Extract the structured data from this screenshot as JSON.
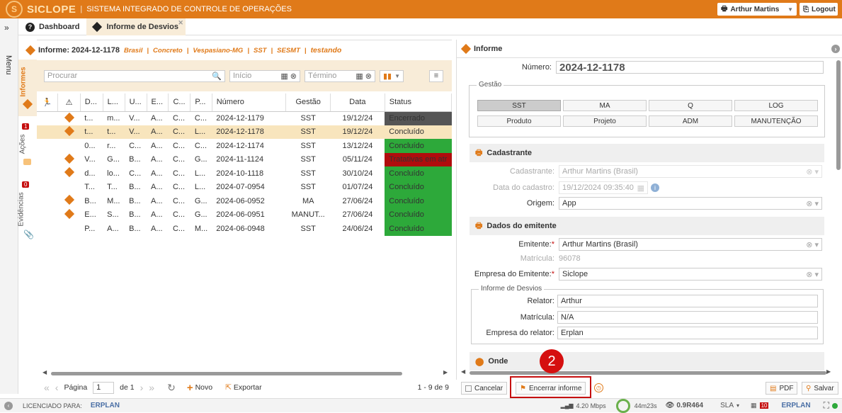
{
  "header": {
    "brand": "SICLOPE",
    "subtitle": "SISTEMA INTEGRADO DE CONTROLE DE OPERAÇÕES",
    "user_label": "Arthur Martins",
    "logout_label": "Logout"
  },
  "side_menu_label": "Menu",
  "tabs": [
    {
      "label": "Dashboard",
      "icon": "help-circle-icon"
    },
    {
      "label": "Informe de Desvios",
      "icon": "diamond-icon"
    }
  ],
  "vertical_tabs": [
    {
      "label": "Informes"
    },
    {
      "label": "Ações",
      "badge": "1"
    },
    {
      "label": "Evidências",
      "badge": "0"
    }
  ],
  "left": {
    "header_title": "Informe: 2024-12-1178",
    "header_tags": [
      "Brasil",
      "Concreto",
      "Vespasiano-MG",
      "SST",
      "SESMT"
    ],
    "header_note": "testando",
    "search_placeholder": "Procurar",
    "start_placeholder": "Início",
    "end_placeholder": "Término",
    "columns": [
      "D...",
      "L...",
      "U...",
      "E...",
      "C...",
      "P...",
      "Número",
      "Gestão",
      "Data",
      "Status"
    ],
    "rows": [
      {
        "flag": true,
        "d": "t...",
        "l": "m...",
        "u": "V...",
        "e": "A...",
        "c": "C...",
        "p": "C...",
        "numero": "2024-12-1179",
        "gestao": "SST",
        "data": "19/12/24",
        "status": "Encerrado",
        "status_type": "enc",
        "selected": false
      },
      {
        "flag": true,
        "d": "t...",
        "l": "t...",
        "u": "V...",
        "e": "A...",
        "c": "C...",
        "p": "L...",
        "numero": "2024-12-1178",
        "gestao": "SST",
        "data": "19/12/24",
        "status": "Concluído",
        "status_type": "con",
        "selected": true
      },
      {
        "flag": false,
        "d": "0...",
        "l": "r...",
        "u": "C...",
        "e": "A...",
        "c": "C...",
        "p": "C...",
        "numero": "2024-12-1174",
        "gestao": "SST",
        "data": "13/12/24",
        "status": "Concluído",
        "status_type": "con",
        "selected": false
      },
      {
        "flag": true,
        "d": "V...",
        "l": "G...",
        "u": "B...",
        "e": "A...",
        "c": "C...",
        "p": "G...",
        "numero": "2024-11-1124",
        "gestao": "SST",
        "data": "05/11/24",
        "status": "Tratativas em atr",
        "status_type": "atr",
        "selected": false
      },
      {
        "flag": true,
        "d": "d...",
        "l": "lo...",
        "u": "C...",
        "e": "A...",
        "c": "C...",
        "p": "L...",
        "numero": "2024-10-1118",
        "gestao": "SST",
        "data": "30/10/24",
        "status": "Concluído",
        "status_type": "con",
        "selected": false
      },
      {
        "flag": false,
        "d": "T...",
        "l": "T...",
        "u": "B...",
        "e": "A...",
        "c": "C...",
        "p": "L...",
        "numero": "2024-07-0954",
        "gestao": "SST",
        "data": "01/07/24",
        "status": "Concluído",
        "status_type": "con",
        "selected": false
      },
      {
        "flag": true,
        "d": "B...",
        "l": "M...",
        "u": "B...",
        "e": "A...",
        "c": "C...",
        "p": "G...",
        "numero": "2024-06-0952",
        "gestao": "MA",
        "data": "27/06/24",
        "status": "Concluído",
        "status_type": "con",
        "selected": false
      },
      {
        "flag": true,
        "d": "E...",
        "l": "S...",
        "u": "B...",
        "e": "A...",
        "c": "C...",
        "p": "G...",
        "numero": "2024-06-0951",
        "gestao": "MANUT...",
        "data": "27/06/24",
        "status": "Concluído",
        "status_type": "con",
        "selected": false
      },
      {
        "flag": false,
        "d": "P...",
        "l": "A...",
        "u": "B...",
        "e": "A...",
        "c": "C...",
        "p": "M...",
        "numero": "2024-06-0948",
        "gestao": "SST",
        "data": "24/06/24",
        "status": "Concluído",
        "status_type": "con",
        "selected": false
      }
    ],
    "pager": {
      "page_label": "Página",
      "page_value": "1",
      "of_label": "de 1",
      "new_label": "Novo",
      "export_label": "Exportar",
      "range": "1 - 9 de 9"
    }
  },
  "right": {
    "title": "Informe",
    "numero_label": "Número:",
    "numero_value": "2024-12-1178",
    "gestao_legend": "Gestão",
    "gestao_buttons": [
      {
        "label": "SST",
        "active": true
      },
      {
        "label": "MA",
        "active": false
      },
      {
        "label": "Q",
        "active": false
      },
      {
        "label": "LOG",
        "active": false
      },
      {
        "label": "Produto",
        "active": false
      },
      {
        "label": "Projeto",
        "active": false
      },
      {
        "label": "ADM",
        "active": false
      },
      {
        "label": "MANUTENÇÃO",
        "active": false
      }
    ],
    "cadastrante_section": "Cadastrante",
    "cadastrante_label": "Cadastrante:",
    "cadastrante_value": "Arthur Martins (Brasil)",
    "data_cadastro_label": "Data do cadastro:",
    "data_cadastro_value": "19/12/2024 09:35:40",
    "origem_label": "Origem:",
    "origem_value": "App",
    "emitente_section": "Dados do emitente",
    "emitente_label": "Emitente:",
    "emitente_value": "Arthur Martins (Brasil)",
    "matricula_label": "Matrícula:",
    "matricula_value": "96078",
    "empresa_emitente_label": "Empresa do Emitente:",
    "empresa_emitente_value": "Siclope",
    "informe_legend": "Informe de Desvios",
    "relator_label": "Relator:",
    "relator_value": "Arthur",
    "matricula2_label": "Matrícula:",
    "matricula2_value": "N/A",
    "empresa_relator_label": "Empresa do relator:",
    "empresa_relator_value": "Erplan",
    "onde_section": "Onde",
    "cancel_label": "Cancelar",
    "close_label": "Encerrar informe",
    "pdf_label": "PDF",
    "save_label": "Salvar"
  },
  "callout_number": "2",
  "status_bar": {
    "license_label": "LICENCIADO PARA:",
    "licensee": "ERPLAN",
    "speed": "4.20 Mbps",
    "time": "44m23s",
    "version": "0.9R464",
    "sla_label": "SLA",
    "notif_count": "10",
    "brand": "ERPLAN"
  },
  "colors": {
    "accent": "#e07a19",
    "concluded": "#2da93a",
    "closed": "#555555",
    "late": "#b00d0d",
    "highlight": "#c50f0f"
  }
}
